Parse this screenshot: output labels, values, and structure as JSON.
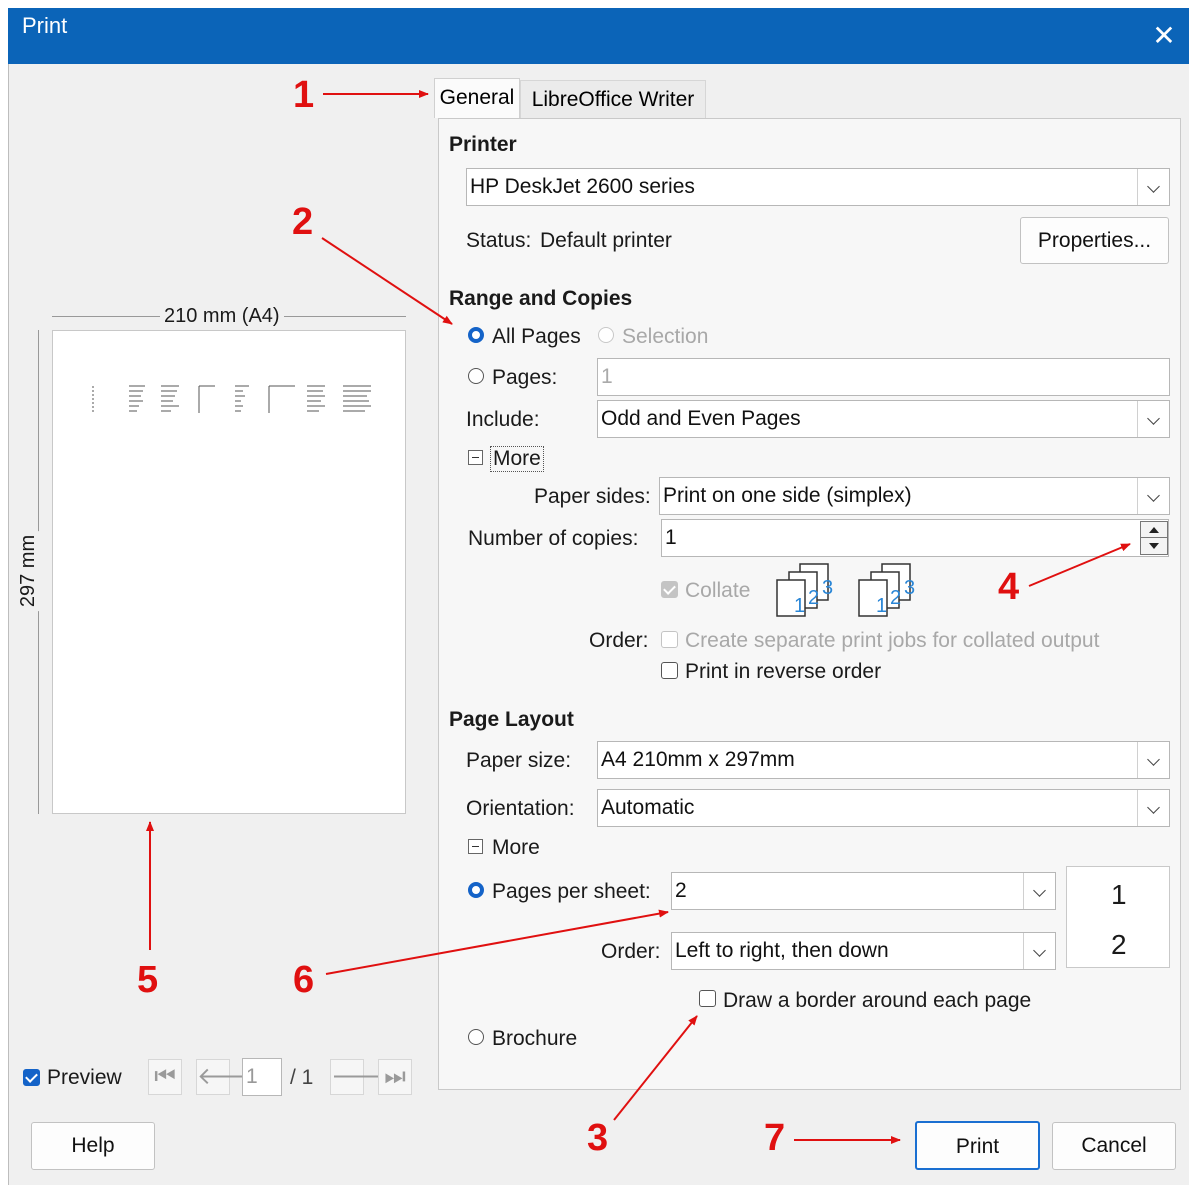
{
  "window": {
    "title": "Print"
  },
  "tabs": [
    "General",
    "LibreOffice Writer"
  ],
  "preview": {
    "width_label": "210 mm (A4)",
    "height_label": "297 mm",
    "checkbox_label": "Preview",
    "page_number": "1",
    "page_total": "/ 1"
  },
  "printer": {
    "section_title": "Printer",
    "selected": "HP DeskJet 2600 series",
    "status_label": "Status:",
    "status_value": "Default printer",
    "properties_button": "Properties..."
  },
  "range": {
    "section_title": "Range and Copies",
    "all_pages": "All Pages",
    "selection": "Selection",
    "pages": "Pages:",
    "pages_value": "1",
    "include_label": "Include:",
    "include_value": "Odd and Even Pages",
    "more": "More",
    "paper_sides_label": "Paper sides:",
    "paper_sides_value": "Print on one side (simplex)",
    "copies_label": "Number of copies:",
    "copies_value": "1",
    "collate": "Collate",
    "order_label": "Order:",
    "separate_jobs": "Create separate print jobs for collated output",
    "reverse_order": "Print in reverse order"
  },
  "layout": {
    "section_title": "Page Layout",
    "paper_size_label": "Paper size:",
    "paper_size_value": "A4 210mm x 297mm",
    "orientation_label": "Orientation:",
    "orientation_value": "Automatic",
    "more": "More",
    "pages_per_sheet_label": "Pages per sheet:",
    "pages_per_sheet_value": "2",
    "order_label": "Order:",
    "order_value": "Left to right, then down",
    "sheet_preview": [
      "1",
      "2"
    ],
    "border_label": "Draw a border around each page",
    "brochure": "Brochure"
  },
  "buttons": {
    "help": "Help",
    "print": "Print",
    "cancel": "Cancel"
  },
  "annotations": [
    "1",
    "2",
    "3",
    "4",
    "5",
    "6",
    "7"
  ],
  "colors": {
    "titlebar": "#0b64b8",
    "annotation": "#e01010",
    "accent": "#1463c8"
  }
}
